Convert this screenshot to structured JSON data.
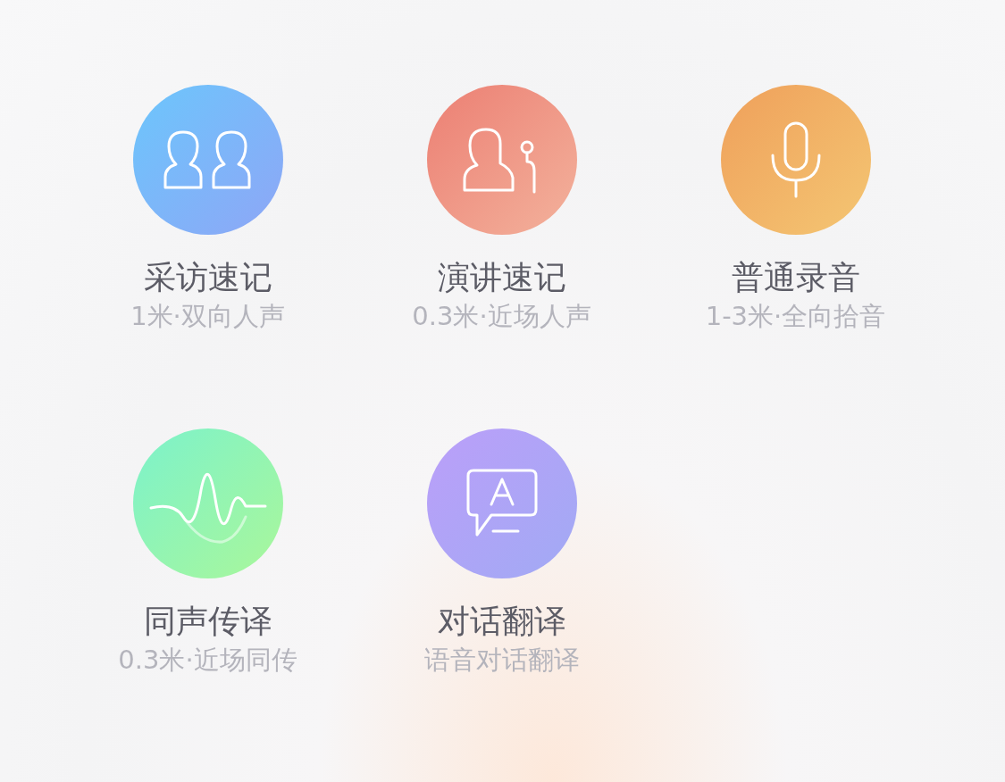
{
  "modes": [
    {
      "kind": "interview",
      "title": "采访速记",
      "subtitle": "1米·双向人声"
    },
    {
      "kind": "speech",
      "title": "演讲速记",
      "subtitle": "0.3米·近场人声"
    },
    {
      "kind": "record",
      "title": "普通录音",
      "subtitle": "1-3米·全向拾音"
    },
    {
      "kind": "interpret",
      "title": "同声传译",
      "subtitle": "0.3米·近场同传"
    },
    {
      "kind": "translate",
      "title": "对话翻译",
      "subtitle": "语音对话翻译"
    }
  ]
}
